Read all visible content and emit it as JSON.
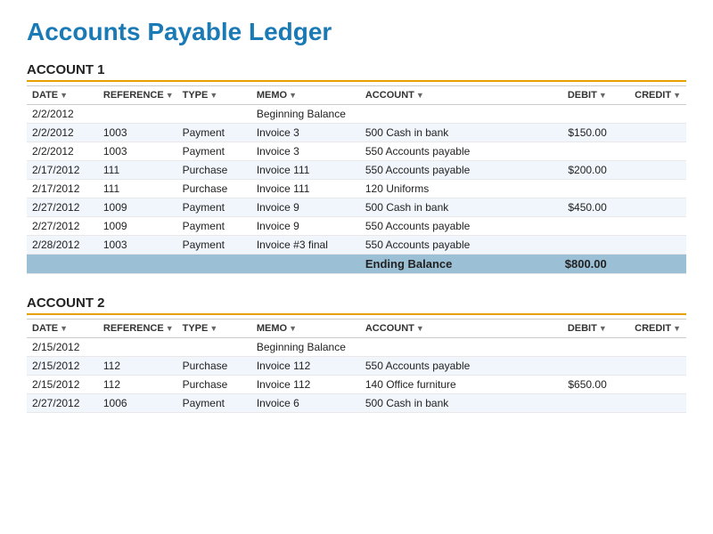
{
  "title": "Accounts Payable Ledger",
  "accounts": [
    {
      "name": "ACCOUNT 1",
      "columns": [
        "DATE",
        "REFERENCE",
        "TYPE",
        "MEMO",
        "ACCOUNT",
        "DEBIT",
        "CREDIT"
      ],
      "rows": [
        {
          "date": "2/2/2012",
          "reference": "",
          "type": "",
          "memo": "Beginning Balance",
          "account": "",
          "debit": "",
          "credit": "",
          "special": "beginning-balance"
        },
        {
          "date": "2/2/2012",
          "reference": "1003",
          "type": "Payment",
          "memo": "Invoice 3",
          "account": "500 Cash in bank",
          "debit": "$150.00",
          "credit": "",
          "special": ""
        },
        {
          "date": "2/2/2012",
          "reference": "1003",
          "type": "Payment",
          "memo": "Invoice 3",
          "account": "550 Accounts payable",
          "debit": "",
          "credit": "",
          "special": ""
        },
        {
          "date": "2/17/2012",
          "reference": "111",
          "type": "Purchase",
          "memo": "Invoice 111",
          "account": "550 Accounts payable",
          "debit": "$200.00",
          "credit": "",
          "special": ""
        },
        {
          "date": "2/17/2012",
          "reference": "111",
          "type": "Purchase",
          "memo": "Invoice 111",
          "account": "120 Uniforms",
          "debit": "",
          "credit": "",
          "special": ""
        },
        {
          "date": "2/27/2012",
          "reference": "1009",
          "type": "Payment",
          "memo": "Invoice 9",
          "account": "500 Cash in bank",
          "debit": "$450.00",
          "credit": "",
          "special": ""
        },
        {
          "date": "2/27/2012",
          "reference": "1009",
          "type": "Payment",
          "memo": "Invoice 9",
          "account": "550 Accounts payable",
          "debit": "",
          "credit": "",
          "special": ""
        },
        {
          "date": "2/28/2012",
          "reference": "1003",
          "type": "Payment",
          "memo": "Invoice #3 final",
          "account": "550 Accounts payable",
          "debit": "",
          "credit": "",
          "special": ""
        },
        {
          "date": "",
          "reference": "",
          "type": "",
          "memo": "",
          "account": "Ending Balance",
          "debit": "$800.00",
          "credit": "",
          "special": "ending-balance"
        }
      ]
    },
    {
      "name": "ACCOUNT 2",
      "columns": [
        "DATE",
        "REFERENCE",
        "TYPE",
        "MEMO",
        "ACCOUNT",
        "DEBIT",
        "CREDIT"
      ],
      "rows": [
        {
          "date": "2/15/2012",
          "reference": "",
          "type": "",
          "memo": "Beginning Balance",
          "account": "",
          "debit": "",
          "credit": "",
          "special": "beginning-balance"
        },
        {
          "date": "2/15/2012",
          "reference": "112",
          "type": "Purchase",
          "memo": "Invoice 112",
          "account": "550 Accounts payable",
          "debit": "",
          "credit": "",
          "special": ""
        },
        {
          "date": "2/15/2012",
          "reference": "112",
          "type": "Purchase",
          "memo": "Invoice 112",
          "account": "140 Office furniture",
          "debit": "$650.00",
          "credit": "",
          "special": ""
        },
        {
          "date": "2/27/2012",
          "reference": "1006",
          "type": "Payment",
          "memo": "Invoice 6",
          "account": "500 Cash in bank",
          "debit": "",
          "credit": "",
          "special": ""
        }
      ]
    }
  ]
}
